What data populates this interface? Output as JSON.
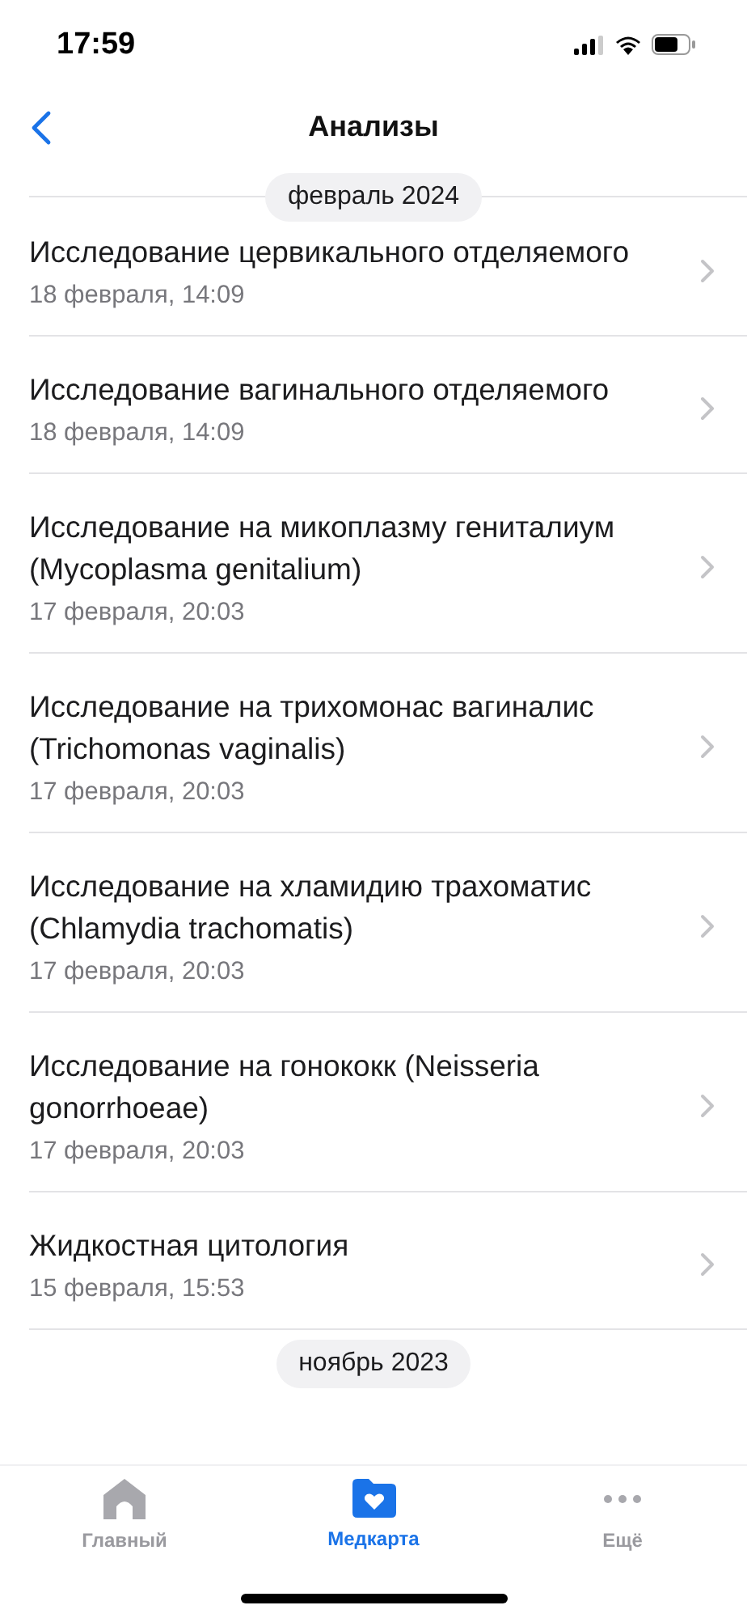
{
  "status_bar": {
    "time": "17:59"
  },
  "nav": {
    "title": "Анализы"
  },
  "sections": [
    {
      "label": "февраль 2024",
      "items": [
        {
          "title": "Исследование цервикального отделяемого",
          "date": "18 февраля, 14:09"
        },
        {
          "title": "Исследование вагинального отделяемого",
          "date": "18 февраля, 14:09"
        },
        {
          "title": "Исследование на микоплазму гениталиум (Mycoplasma genitalium)",
          "date": "17 февраля, 20:03"
        },
        {
          "title": "Исследование на трихомонас вагиналис (Trichomonas vaginalis)",
          "date": "17 февраля, 20:03"
        },
        {
          "title": "Исследование на хламидию трахоматис (Chlamydia trachomatis)",
          "date": "17 февраля, 20:03"
        },
        {
          "title": "Исследование на гонококк (Neisseria gonorrhoeae)",
          "date": "17 февраля, 20:03"
        },
        {
          "title": "Жидкостная цитология",
          "date": "15 февраля, 15:53"
        }
      ]
    },
    {
      "label": "ноябрь 2023"
    }
  ],
  "tab_bar": [
    {
      "kind": "home",
      "label": "Главный",
      "selected": false
    },
    {
      "kind": "medcard",
      "label": "Медкарта",
      "selected": true
    },
    {
      "kind": "more",
      "label": "Ещё",
      "selected": false
    }
  ]
}
